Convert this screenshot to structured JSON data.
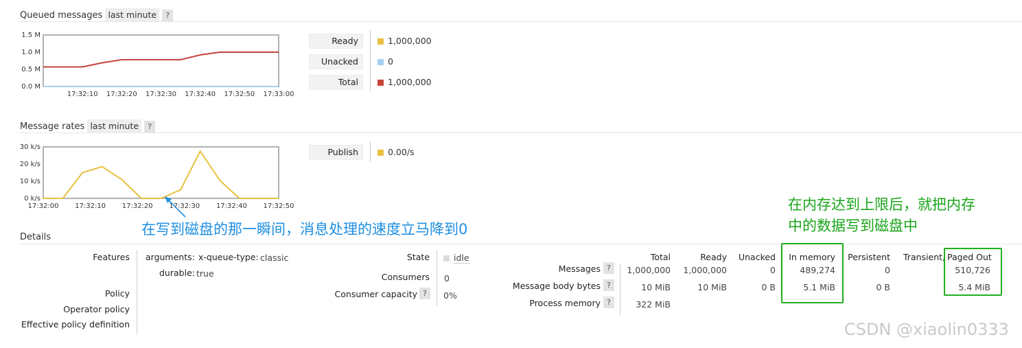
{
  "queued": {
    "title": "Queued messages",
    "range": "last minute",
    "help": "?",
    "legend": [
      {
        "label": "Ready",
        "value": "1,000,000",
        "color": "#e8c040"
      },
      {
        "label": "Unacked",
        "value": "0",
        "color": "#a8d0f0"
      },
      {
        "label": "Total",
        "value": "1,000,000",
        "color": "#c6443a"
      }
    ]
  },
  "rates": {
    "title": "Message rates",
    "range": "last minute",
    "help": "?",
    "legend": [
      {
        "label": "Publish",
        "value": "0.00/s",
        "color": "#e8c040"
      }
    ]
  },
  "chart_data": [
    {
      "type": "line",
      "title": "Queued messages",
      "y_ticks": [
        "1.5 M",
        "1.0 M",
        "0.5 M",
        "0.0 M"
      ],
      "x_ticks": [
        "17:32:10",
        "17:32:20",
        "17:32:30",
        "17:32:40",
        "17:32:50",
        "17:33:00"
      ],
      "ylim": [
        0,
        1.5
      ],
      "x_seconds": [
        0,
        10,
        20,
        30,
        40,
        50,
        60,
        70,
        80,
        90,
        100,
        110,
        120
      ],
      "series": [
        {
          "name": "Total",
          "color": "#c6443a",
          "values": [
            0.57,
            0.57,
            0.57,
            0.69,
            0.78,
            0.78,
            0.78,
            0.78,
            0.92,
            1.0,
            1.0,
            1.0,
            1.0
          ]
        },
        {
          "name": "Unacked",
          "color": "#a8d0f0",
          "values": [
            0,
            0,
            0,
            0,
            0,
            0,
            0,
            0,
            0,
            0,
            0,
            0,
            0
          ]
        }
      ]
    },
    {
      "type": "line",
      "title": "Message rates",
      "y_ticks": [
        "30 k/s",
        "20 k/s",
        "10 k/s",
        "0 k/s"
      ],
      "x_ticks": [
        "17:32:00",
        "17:32:10",
        "17:32:20",
        "17:32:30",
        "17:32:40",
        "17:32:50"
      ],
      "ylim": [
        0,
        30
      ],
      "x_seconds": [
        0,
        5,
        10,
        15,
        20,
        25,
        30,
        35,
        40,
        45,
        50,
        55,
        60
      ],
      "series": [
        {
          "name": "Publish",
          "color": "#e8c040",
          "values": [
            0,
            0,
            15,
            18.5,
            11,
            0,
            0,
            5,
            27.5,
            10.5,
            0,
            0,
            0
          ]
        }
      ]
    }
  ],
  "annotations": {
    "blue": "在写到磁盘的那一瞬间，消息处理的速度立马降到0",
    "green_line1": "在内存达到上限后，就把内存",
    "green_line2": "中的数据写到磁盘中"
  },
  "details": {
    "title": "Details",
    "features_label": "Features",
    "arg_key": "arguments:",
    "arg_name": "x-queue-type:",
    "arg_value": "classic",
    "durable_key": "durable:",
    "durable_value": "true",
    "policy_label": "Policy",
    "operator_policy_label": "Operator policy",
    "effective_policy_label": "Effective policy definition",
    "state_label": "State",
    "state_value": "idle",
    "consumers_label": "Consumers",
    "consumers_value": "0",
    "consumer_capacity_label": "Consumer capacity",
    "consumer_capacity_value": "0%",
    "help": "?",
    "columns": [
      "Total",
      "Ready",
      "Unacked",
      "In memory",
      "Persistent",
      "Transient,",
      "Paged Out"
    ],
    "rows": [
      {
        "label": "Messages",
        "total": "1,000,000",
        "ready": "1,000,000",
        "unacked": "0",
        "in_memory": "489,274",
        "persistent": "0",
        "paged_out": "510,726"
      },
      {
        "label": "Message body bytes",
        "total": "10 MiB",
        "ready": "10 MiB",
        "unacked": "0 B",
        "in_memory": "5.1 MiB",
        "persistent": "0 B",
        "paged_out": "5.4 MiB"
      },
      {
        "label": "Process memory",
        "total": "322 MiB"
      }
    ]
  },
  "watermark": "CSDN @xiaolin0333"
}
